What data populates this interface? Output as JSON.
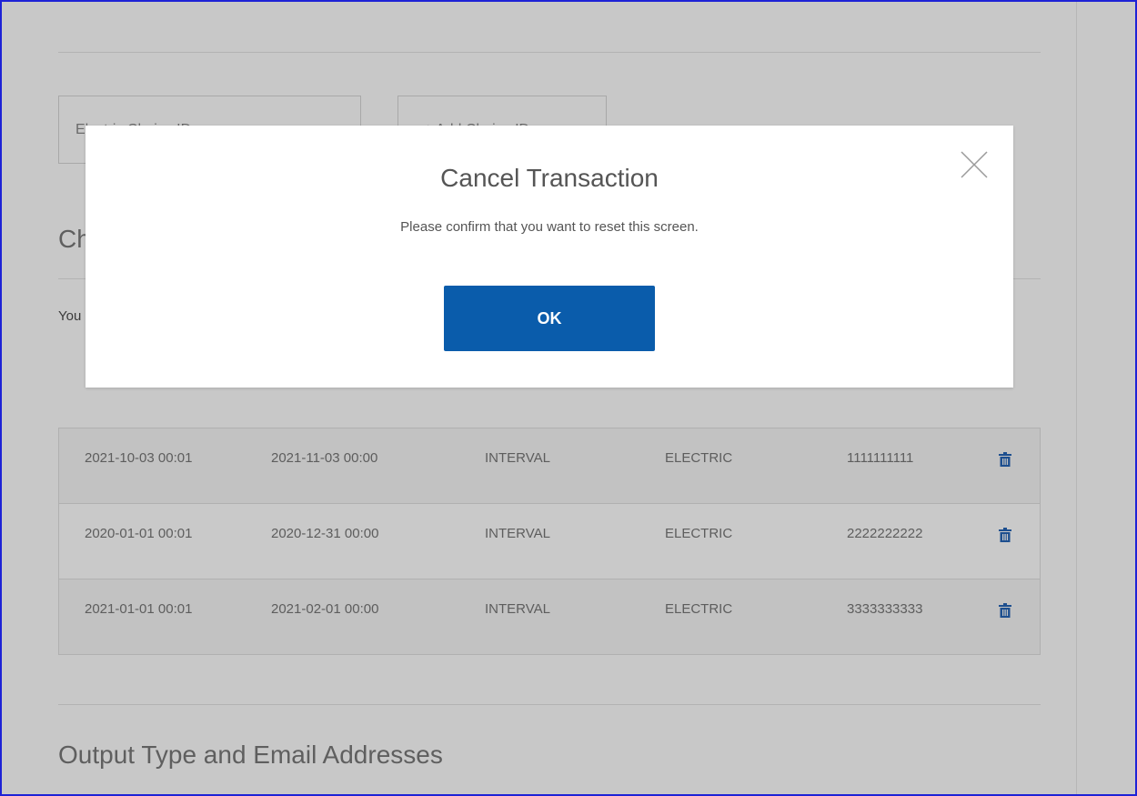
{
  "background": {
    "choice_input_text": "Electric Choice ID",
    "add_choice_button_label": "+ Add Choice ID",
    "chosen_section_title": "Ch",
    "section_note": "You",
    "output_section_title": "Output Type and Email Addresses"
  },
  "table": {
    "rows": [
      {
        "start": "2021-10-03 00:01",
        "end": "2021-11-03 00:00",
        "type": "INTERVAL",
        "commodity": "ELECTRIC",
        "id": "1111111111"
      },
      {
        "start": "2020-01-01 00:01",
        "end": "2020-12-31 00:00",
        "type": "INTERVAL",
        "commodity": "ELECTRIC",
        "id": "2222222222"
      },
      {
        "start": "2021-01-01 00:01",
        "end": "2021-02-01 00:00",
        "type": "INTERVAL",
        "commodity": "ELECTRIC",
        "id": "3333333333"
      }
    ]
  },
  "modal": {
    "title": "Cancel Transaction",
    "message": "Please confirm that you want to reset this screen.",
    "ok_label": "OK"
  },
  "colors": {
    "primary": "#0a5cab",
    "overlay": "#c8c8c8",
    "trash_icon": "#1d4f8f"
  },
  "icons": {
    "close": "close-icon",
    "delete": "trash-icon"
  }
}
